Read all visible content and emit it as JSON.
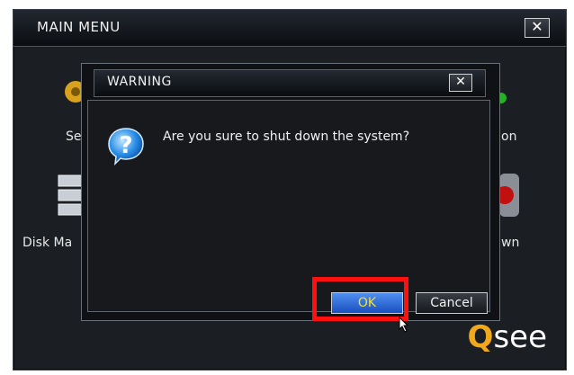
{
  "main_window": {
    "title": "MAIN MENU",
    "close_glyph": "✕",
    "labels": {
      "setup": "Se",
      "shutdown_top": "on",
      "disk": "Disk Ma",
      "shutdown_bottom": "wn"
    },
    "icons": [
      "gear-icon",
      "disk-management-icon",
      "shutdown-icon"
    ]
  },
  "warning_dialog": {
    "title": "WARNING",
    "close_glyph": "✕",
    "message": "Are you sure to shut down the system?",
    "ok_label": "OK",
    "cancel_label": "Cancel",
    "icon": "question-mark-icon"
  },
  "logo": {
    "q": "Q",
    "rest": "see"
  },
  "colors": {
    "highlight": "#ff1010",
    "ok_text": "#f0e030",
    "ok_bg": "#2a63d8",
    "logo_accent": "#f2a81d"
  }
}
